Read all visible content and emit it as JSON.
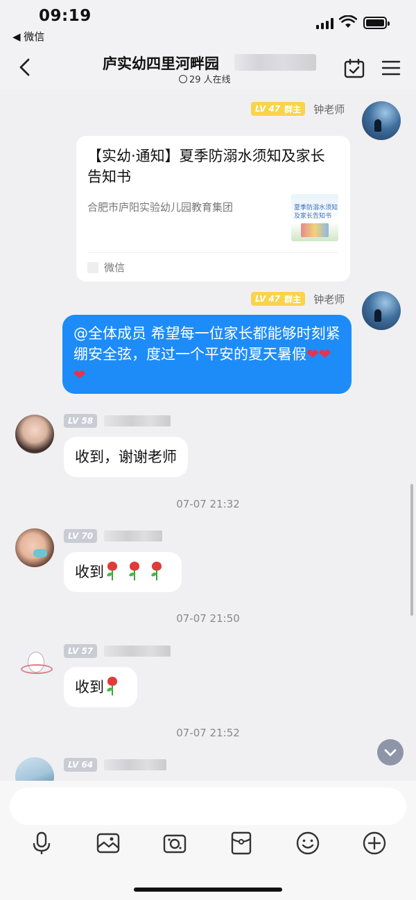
{
  "status_bar": {
    "time": "09:19",
    "back_app": "◀ 微信"
  },
  "header": {
    "title": "庐实幼四里河畔园",
    "online": "29 人在线"
  },
  "messages": [
    {
      "sender": "钟老师",
      "level": "LV 47",
      "role": "群主",
      "card": {
        "title": "【实幼·通知】夏季防溺水须知及家长告知书",
        "source": "合肥市庐阳实验幼儿园教育集团",
        "thumb_text": "夏季防溺水须知\n及家长告知书",
        "footer": "微信"
      }
    },
    {
      "sender": "钟老师",
      "level": "LV 47",
      "role": "群主",
      "text": "@全体成员  希望每一位家长都能够时刻紧绷安全弦，度过一个平安的夏天暑假",
      "hearts": "❤❤❤"
    },
    {
      "level": "LV 58",
      "text": "收到，谢谢老师"
    },
    {
      "timestamp": "07-07 21:32"
    },
    {
      "level": "LV 70",
      "text": "收到"
    },
    {
      "timestamp": "07-07 21:50"
    },
    {
      "level": "LV 57",
      "text": "收到"
    },
    {
      "timestamp": "07-07 21:52"
    },
    {
      "level": "LV 64"
    }
  ],
  "input": {
    "placeholder": ""
  },
  "toolbar": [
    "mic-icon",
    "image-icon",
    "camera-icon",
    "red-packet-icon",
    "emoji-icon",
    "plus-icon"
  ],
  "colors": {
    "accent_blue": "#1d8cf8",
    "owner_badge": "#f7d44a",
    "level_badge": "#c9ccd3"
  }
}
